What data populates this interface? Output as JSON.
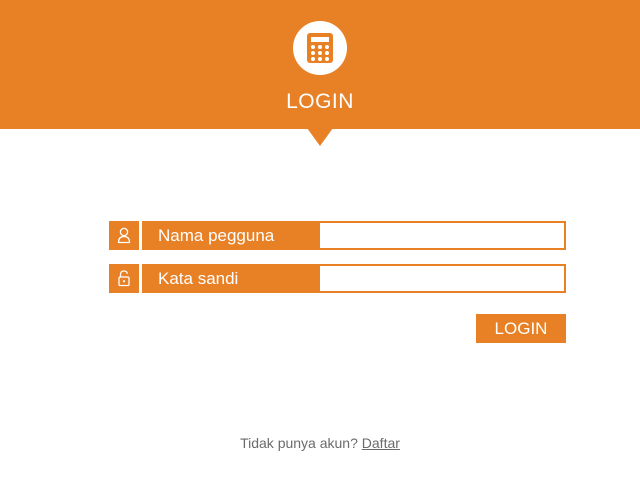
{
  "header": {
    "title": "LOGIN",
    "logo_icon": "calculator-icon",
    "background_color": "#e88026"
  },
  "form": {
    "username": {
      "icon": "user-icon",
      "label": "Nama pegguna",
      "value": "",
      "placeholder": ""
    },
    "password": {
      "icon": "lock-icon",
      "label": "Kata sandi",
      "value": "",
      "placeholder": ""
    },
    "submit_label": "LOGIN"
  },
  "footer": {
    "prompt": "Tidak punya akun?",
    "register_link": "Daftar"
  },
  "colors": {
    "accent": "#e88026",
    "text_muted": "#6b6b6b",
    "background": "#ffffff"
  }
}
